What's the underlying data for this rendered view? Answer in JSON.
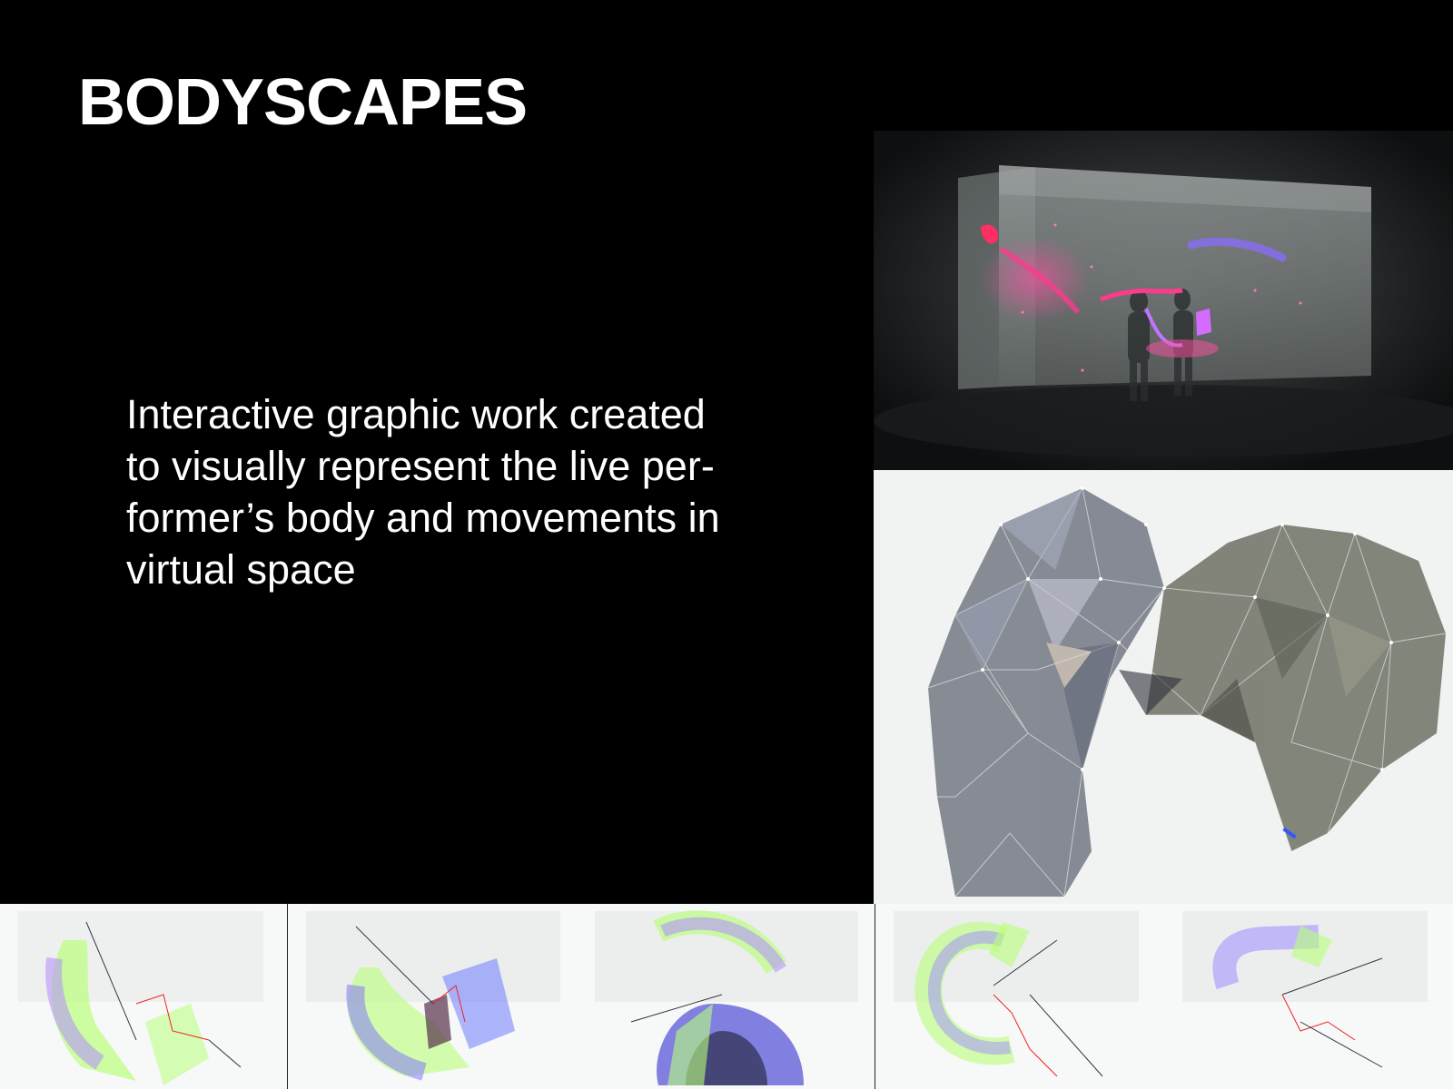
{
  "title": "BODYSCAPES",
  "description": {
    "lines": [
      "Interactive graphic work created",
      "to visually represent the live per-",
      "former’s body and movements in",
      "virtual space"
    ]
  },
  "images": {
    "stage": "performance-stage-projection",
    "mesh": "polygonal-body-mesh",
    "thumbnails": [
      "mesh-frame-1",
      "mesh-frame-2",
      "mesh-frame-3",
      "mesh-frame-4",
      "mesh-frame-5"
    ]
  },
  "colors": {
    "background": "#000000",
    "text": "#ffffff",
    "accent_pink": "#ff3a8c",
    "accent_violet": "#8a6cff",
    "accent_green": "#b9ff7a"
  }
}
